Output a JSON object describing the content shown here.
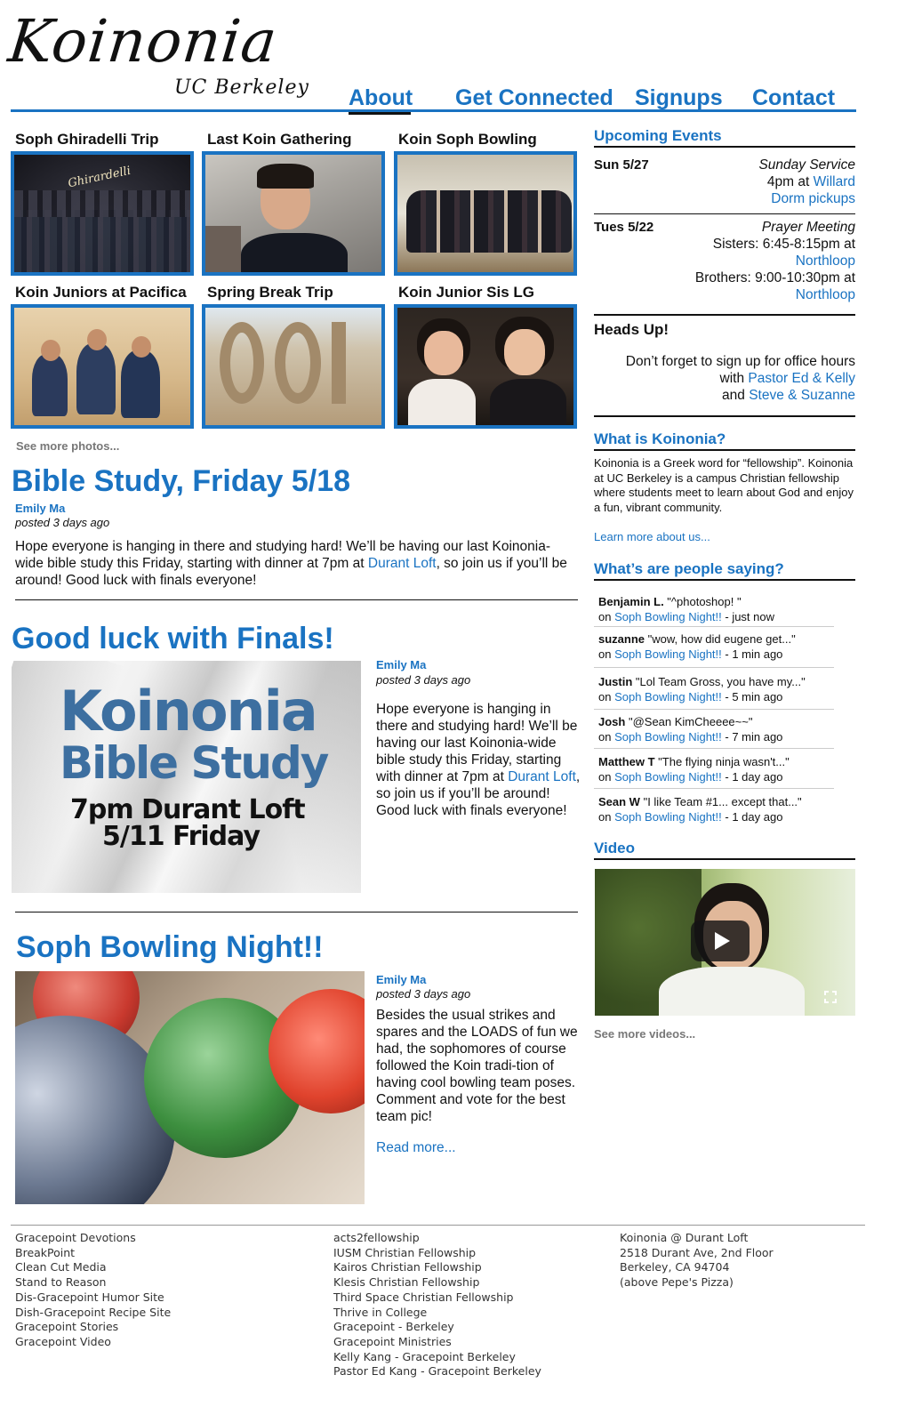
{
  "header": {
    "logo_main": "Koinonia",
    "logo_sub": "UC Berkeley",
    "nav": [
      "About",
      "Get Connected",
      "Signups",
      "Contact"
    ]
  },
  "photos": {
    "items": [
      {
        "title": "Soph Ghiradelli Trip"
      },
      {
        "title": "Last Koin Gathering"
      },
      {
        "title": "Koin Soph Bowling"
      },
      {
        "title": "Koin Juniors at Pacifica"
      },
      {
        "title": "Spring Break Trip"
      },
      {
        "title": "Koin Junior Sis LG"
      }
    ],
    "sign1": "Ghirardelli",
    "more": "See more photos..."
  },
  "posts": [
    {
      "title": "Bible Study, Friday 5/18",
      "author": "Emily Ma",
      "date": "posted 3 days ago",
      "body_a": "Hope everyone is hanging in there and studying hard! We’ll be having our last Koinonia-wide bible study this Friday, starting with dinner at 7pm at ",
      "link": "Durant Loft",
      "body_b": ", so join us if you’ll be around! Good luck with finals everyone!"
    },
    {
      "title": "Good luck with Finals!",
      "author": "Emily Ma",
      "date": "posted 3 days ago",
      "body_a": "Hope everyone is hanging in there and studying hard! We’ll be having our last Koinonia-wide bible study this Friday, starting with dinner at 7pm at ",
      "link": "Durant Loft",
      "body_b": ", so join us if you’ll be around! Good luck with finals everyone!",
      "flyer": {
        "line1": "Koinonia",
        "line2": "Bible Study",
        "line3": "7pm Durant Loft",
        "line4": "5/11 Friday"
      }
    },
    {
      "title": "Soph Bowling Night!!",
      "author": "Emily Ma",
      "date": "posted 3 days ago",
      "body": "Besides the usual strikes and spares and the LOADS of fun we had, the sophomores of course followed the Koin tradi-tion of having cool bowling team poses. Comment and vote for the best team pic!",
      "read_more": "Read more..."
    }
  ],
  "sidebar": {
    "upcoming_title": "Upcoming Events",
    "events": [
      {
        "date": "Sun 5/27",
        "title": "Sunday Service",
        "l1a": "4pm at ",
        "l1link": "Willard",
        "l2link": "Dorm pickups"
      },
      {
        "date": "Tues 5/22",
        "title": "Prayer Meeting",
        "l1a": "Sisters: 6:45-8:15pm at",
        "l1link": "Northloop",
        "l2a": "Brothers: 9:00-10:30pm at",
        "l2link": "Northloop"
      }
    ],
    "headsup_title": "Heads Up!",
    "headsup_l1": "Don’t forget to sign up for office hours",
    "headsup_l2a": "with ",
    "headsup_l2link": "Pastor Ed & Kelly",
    "headsup_l3a": "and ",
    "headsup_l3link": "Steve & Suzanne",
    "what_title": "What is Koinonia?",
    "what_body": "Koinonia is a Greek word for “fellowship”. Koinonia at UC Berkeley is a campus Christian fellowship where students meet to learn about God and enjoy a fun, vibrant community.",
    "learn_more": "Learn more about us...",
    "saying_title": "What’s are people saying?",
    "comments": [
      {
        "who": "Benjamin L.",
        "text": " \"^photoshop!  \"",
        "on": "on ",
        "link": "Soph Bowling Night!!",
        "when": " - just now"
      },
      {
        "who": "suzanne",
        "text": " \"wow, how did eugene get...\"",
        "on": "on ",
        "link": "Soph Bowling Night!!",
        "when": " - 1 min ago"
      },
      {
        "who": "Justin",
        "text": " \"Lol Team Gross, you have my...\"",
        "on": "on ",
        "link": "Soph Bowling Night!!",
        "when": " - 5 min ago"
      },
      {
        "who": "Josh",
        "text": " \"@Sean KimCheeee~~\"",
        "on": "on ",
        "link": "Soph Bowling Night!!",
        "when": " - 7 min ago"
      },
      {
        "who": "Matthew T",
        "text": " \"The flying ninja wasn't...\"",
        "on": "on ",
        "link": "Soph Bowling Night!!",
        "when": " - 1 day ago"
      },
      {
        "who": "Sean W",
        "text": " \"I like Team #1... except that...\"",
        "on": "on ",
        "link": "Soph Bowling Night!!",
        "when": " - 1 day ago"
      }
    ],
    "video_title": "Video",
    "video_more": "See more videos..."
  },
  "footer": {
    "col1": [
      "Gracepoint Devotions",
      "BreakPoint",
      "Clean Cut Media",
      "Stand to Reason",
      "Dis-Gracepoint Humor Site",
      "Dish-Gracepoint Recipe Site",
      "Gracepoint Stories",
      "Gracepoint Video"
    ],
    "col2": [
      "acts2fellowship",
      "IUSM Christian Fellowship",
      "Kairos Christian Fellowship",
      "Klesis Christian Fellowship",
      "Third Space Christian Fellowship",
      "Thrive in College",
      "Gracepoint - Berkeley",
      "Gracepoint Ministries",
      "Kelly Kang - Gracepoint Berkeley",
      "Pastor Ed Kang - Gracepoint Berkeley"
    ],
    "col3": [
      "Koinonia @ Durant Loft",
      "2518 Durant Ave, 2nd Floor",
      "Berkeley, CA 94704",
      "(above Pepe's Pizza)"
    ]
  }
}
